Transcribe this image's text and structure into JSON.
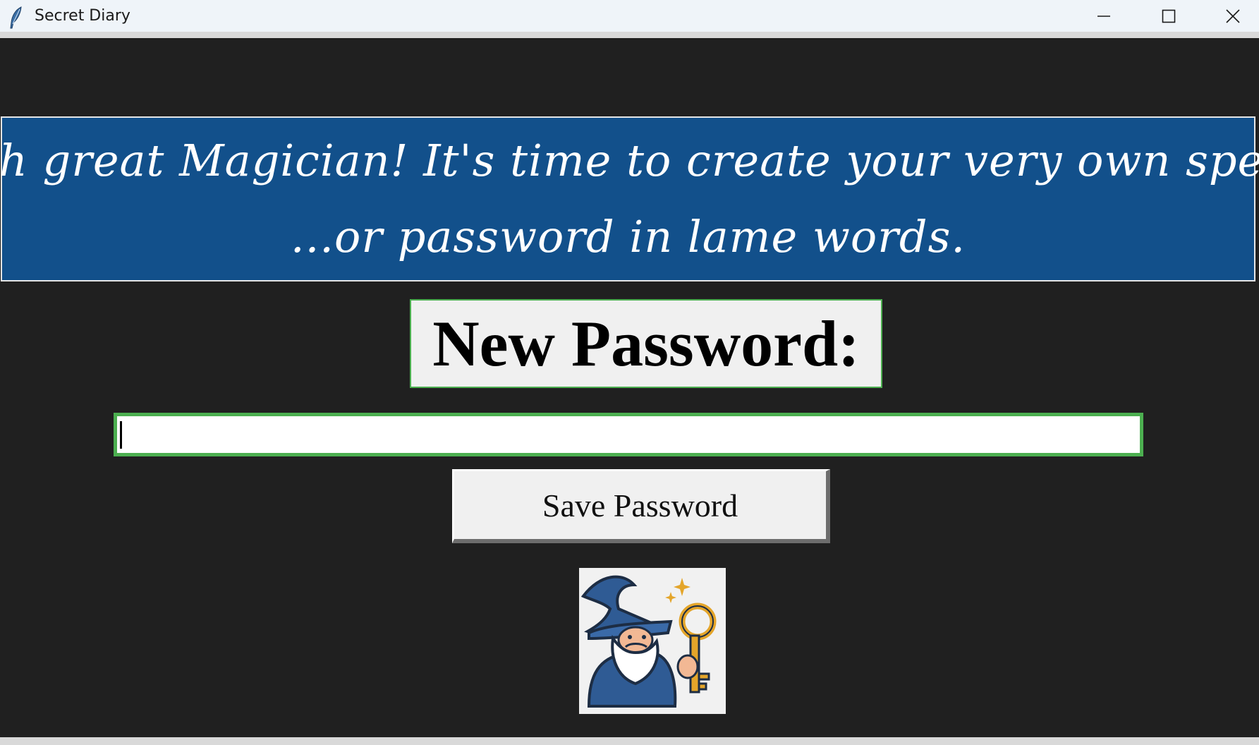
{
  "window": {
    "title": "Secret Diary",
    "app_icon": "feather-icon",
    "controls": {
      "minimize_icon": "minimize-icon",
      "maximize_icon": "maximize-icon",
      "close_icon": "close-icon"
    }
  },
  "banner": {
    "line1": "Oh great Magician! It's time to create your very own spell",
    "line2": "...or password in lame words.",
    "background_color": "#12508b",
    "text_color": "#ffffff"
  },
  "password_label": {
    "text": "New Password:",
    "border_color": "#4caf50"
  },
  "password_input": {
    "value": "",
    "placeholder": "",
    "border_color": "#4caf50"
  },
  "save_button": {
    "label": "Save Password"
  },
  "wizard_image": {
    "icon": "wizard-with-key-icon"
  },
  "colors": {
    "window_bg": "#202020",
    "accent_green": "#4caf50"
  }
}
